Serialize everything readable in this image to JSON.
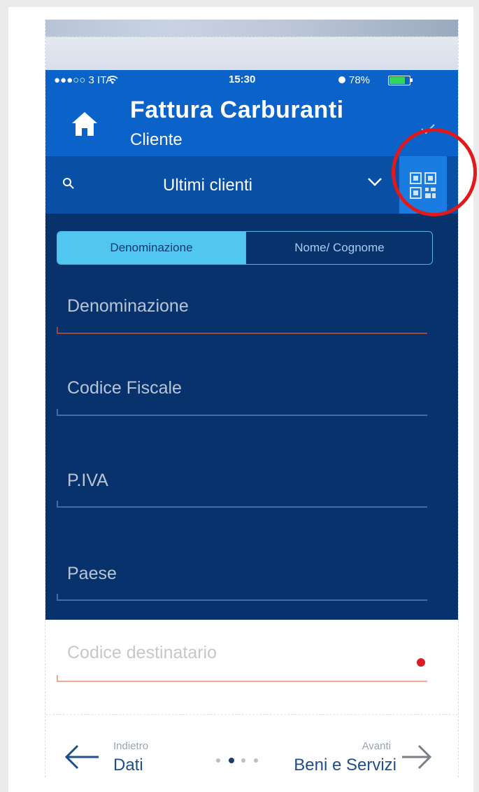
{
  "status_bar": {
    "carrier": "●●●○○ 3 ITA",
    "time": "15:30",
    "battery": "78%"
  },
  "header": {
    "title": "Fattura Carburanti",
    "subtitle": "Cliente"
  },
  "search": {
    "label": "Ultimi clienti"
  },
  "tabs": [
    {
      "label": "Denominazione",
      "active": true
    },
    {
      "label": "Nome/ Cognome",
      "active": false
    }
  ],
  "fields": [
    {
      "placeholder": "Denominazione",
      "state": "error"
    },
    {
      "placeholder": "Codice Fiscale",
      "state": "normal"
    },
    {
      "placeholder": "P.IVA",
      "state": "normal"
    },
    {
      "placeholder": "Paese",
      "state": "normal"
    }
  ],
  "destinatario": {
    "placeholder": "Codice destinatario",
    "required": true
  },
  "navigation": {
    "back_small": "Indietro",
    "back_label": "Dati",
    "next_small": "Avanti",
    "next_label": "Beni e Servizi",
    "pages": 4,
    "current_page": 2
  },
  "colors": {
    "header": "#0b63c9",
    "search_bar": "#0a4fa6",
    "form_background": "#07326b",
    "active_tab": "#51c6f0",
    "highlight": "#e01a1a"
  },
  "icons": [
    "home-icon",
    "check-icon",
    "search-icon",
    "chevron-down-icon",
    "qr-code-icon",
    "arrow-left-icon",
    "arrow-right-icon"
  ]
}
